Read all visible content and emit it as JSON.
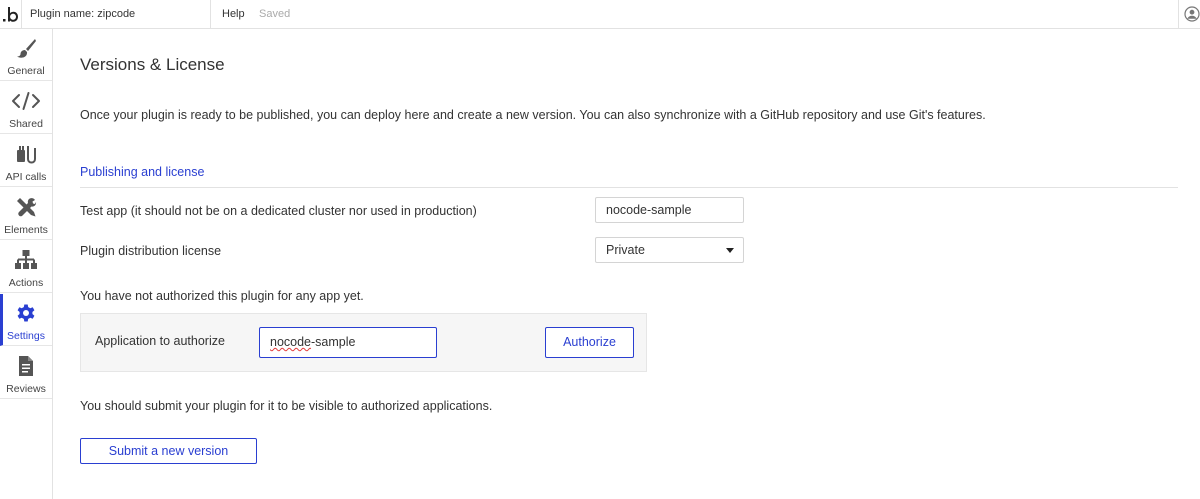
{
  "header": {
    "plugin_name": "Plugin name: zipcode",
    "help_label": "Help",
    "status": "Saved",
    "icons": {
      "logo": "bubble-logo-icon",
      "user": "user-avatar-icon"
    }
  },
  "sidebar": {
    "items": [
      {
        "label": "General",
        "icon": "paintbrush-icon"
      },
      {
        "label": "Shared",
        "icon": "code-brackets-icon"
      },
      {
        "label": "API calls",
        "icon": "plug-icon"
      },
      {
        "label": "Elements",
        "icon": "tools-icon"
      },
      {
        "label": "Actions",
        "icon": "workflow-icon"
      },
      {
        "label": "Settings",
        "icon": "gear-icon",
        "active": true
      },
      {
        "label": "Reviews",
        "icon": "document-icon"
      }
    ]
  },
  "main": {
    "title": "Versions & License",
    "intro": "Once your plugin is ready to be published, you can deploy here and create a new version. You can also synchronize with a GitHub repository and use Git's features.",
    "section_title": "Publishing and license",
    "test_app_label": "Test app (it should not be on a dedicated cluster nor used in production)",
    "test_app_value": "nocode-sample",
    "license_label": "Plugin distribution license",
    "license_value": "Private",
    "not_authorized_notice": "You have not authorized this plugin for any app yet.",
    "authorize": {
      "label": "Application to authorize",
      "input_spell": "nocode",
      "input_rest": "-sample",
      "button_label": "Authorize"
    },
    "submit_notice": "You should submit your plugin for it to be visible to authorized applications.",
    "submit_button": "Submit a new version"
  },
  "colors": {
    "accent": "#2a3fd1",
    "sidebar_icon": "#555555",
    "border": "#e2e2e2",
    "panel_bg": "#f6f6f6"
  }
}
